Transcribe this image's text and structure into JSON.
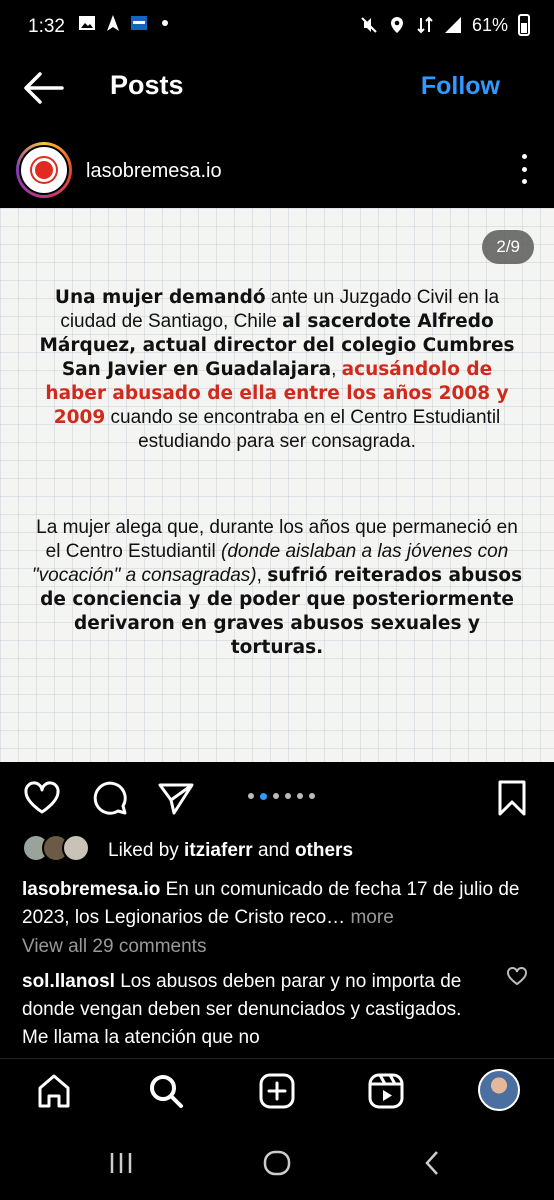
{
  "status_bar": {
    "time": "1:32",
    "battery": "61%"
  },
  "header": {
    "title": "Posts",
    "follow_label": "Follow"
  },
  "post": {
    "username": "lasobremesa.io",
    "slide_counter": "2/9",
    "carousel": {
      "total": 6,
      "active_index": 1
    },
    "paragraph1": [
      {
        "text": "Una mujer demandó",
        "style": "bold"
      },
      {
        "text": " ante un Juzgado Civil en la ciudad de Santiago, Chile ",
        "style": "normal"
      },
      {
        "text": "al sacerdote Alfredo Márquez, actual director del colegio Cumbres San Javier en Guadalajara",
        "style": "bold"
      },
      {
        "text": ", ",
        "style": "normal"
      },
      {
        "text": "acusándolo de haber abusado de ella entre los años 2008 y 2009",
        "style": "red"
      },
      {
        "text": " cuando se encontraba en el Centro Estudiantil estudiando para ser consagrada.",
        "style": "normal"
      }
    ],
    "paragraph2": [
      {
        "text": "La mujer alega que, durante los años que permaneció en el Centro Estudiantil ",
        "style": "normal"
      },
      {
        "text": "(donde aislaban a las jóvenes con \"vocación\" a consagradas)",
        "style": "italic"
      },
      {
        "text": ", ",
        "style": "normal"
      },
      {
        "text": "sufrió reiterados abusos de conciencia y de poder que posteriormente derivaron en graves abusos sexuales y torturas.",
        "style": "bold"
      }
    ]
  },
  "likes": {
    "prefix": "Liked by ",
    "user": "itziaferr",
    "middle": " and ",
    "others": "others"
  },
  "caption": {
    "username": "lasobremesa.io",
    "text": " En un comunicado de fecha 17 de julio de 2023, los Legionarios de Cristo reco… ",
    "more": "more"
  },
  "view_all_comments": "View all 29 comments",
  "comment": {
    "username": "sol.llanosl",
    "text": " Los abusos deben parar y no importa de donde vengan deben ser denunciados y castigados. Me llama la atención que no"
  },
  "colors": {
    "accent": "#2f9bff",
    "red_highlight": "#d12a1c"
  }
}
